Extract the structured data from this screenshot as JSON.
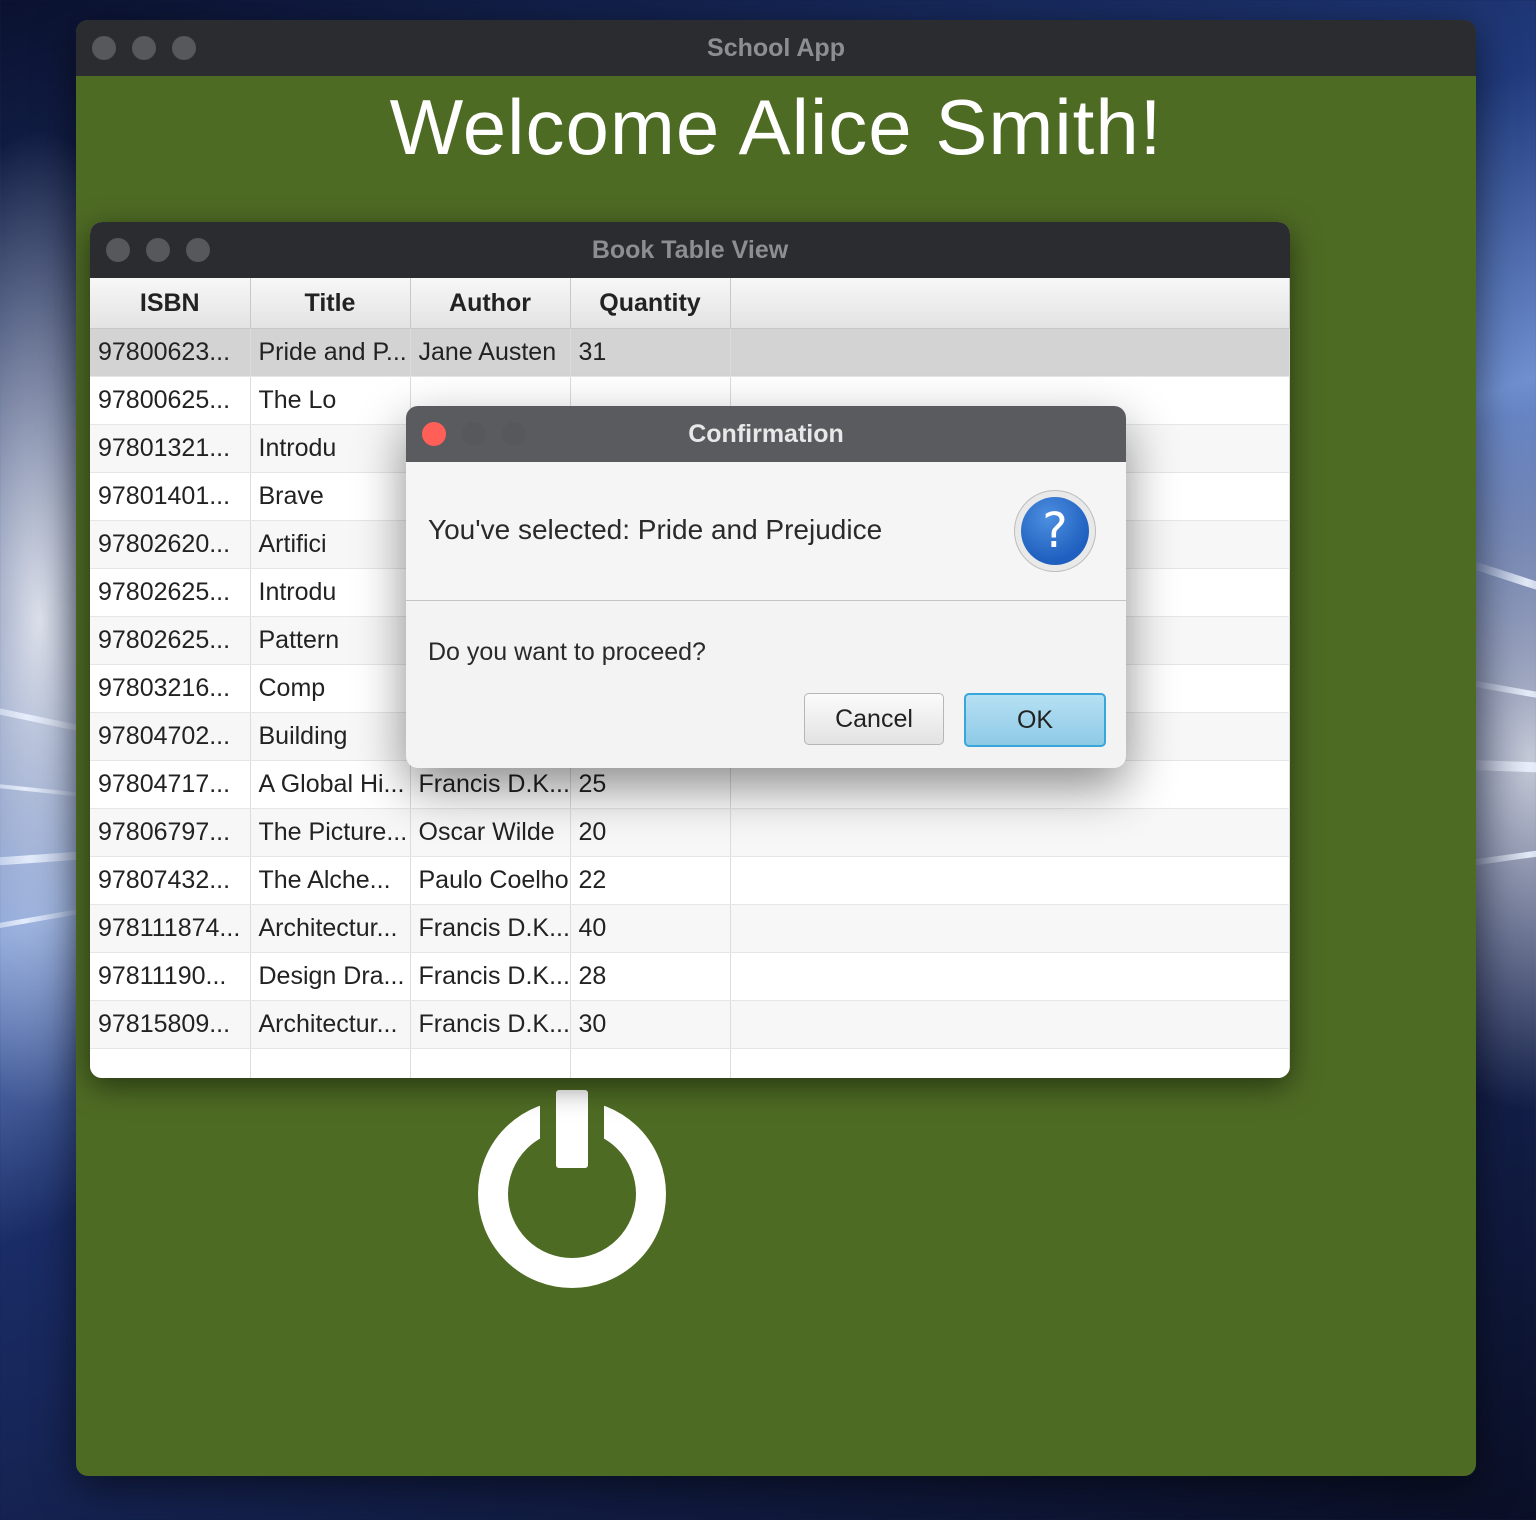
{
  "main_window": {
    "title": "School App",
    "welcome": "Welcome Alice Smith!"
  },
  "book_window": {
    "title": "Book Table View",
    "columns": [
      "ISBN",
      "Title",
      "Author",
      "Quantity"
    ],
    "rows": [
      [
        "97800623...",
        "Pride and P...",
        "Jane Austen",
        "31"
      ],
      [
        "97800625...",
        "The Lo",
        "",
        ""
      ],
      [
        "97801321...",
        "Introdu",
        "",
        ""
      ],
      [
        "97801401...",
        "Brave",
        "",
        ""
      ],
      [
        "97802620...",
        "Artifici",
        "",
        ""
      ],
      [
        "97802625...",
        "Introdu",
        "",
        ""
      ],
      [
        "97802625...",
        "Pattern",
        "",
        ""
      ],
      [
        "97803216...",
        "Comp",
        "",
        ""
      ],
      [
        "97804702...",
        "Building",
        "",
        ""
      ],
      [
        "97804717...",
        "A Global Hi...",
        "Francis D.K...",
        "25"
      ],
      [
        "97806797...",
        "The Picture...",
        "Oscar Wilde",
        "20"
      ],
      [
        "97807432...",
        "The Alche...",
        "Paulo Coelho",
        "22"
      ],
      [
        "978111874...",
        "Architectur...",
        "Francis D.K...",
        "40"
      ],
      [
        "97811190...",
        "Design Dra...",
        "Francis D.K...",
        "28"
      ],
      [
        "97815809...",
        "Architectur...",
        "Francis D.K...",
        "30"
      ],
      [
        "",
        "",
        "",
        ""
      ]
    ]
  },
  "dialog": {
    "title": "Confirmation",
    "header": "You've selected: Pride and Prejudice",
    "content": "Do you want to proceed?",
    "cancel_label": "Cancel",
    "ok_label": "OK",
    "icon": "question-icon"
  }
}
